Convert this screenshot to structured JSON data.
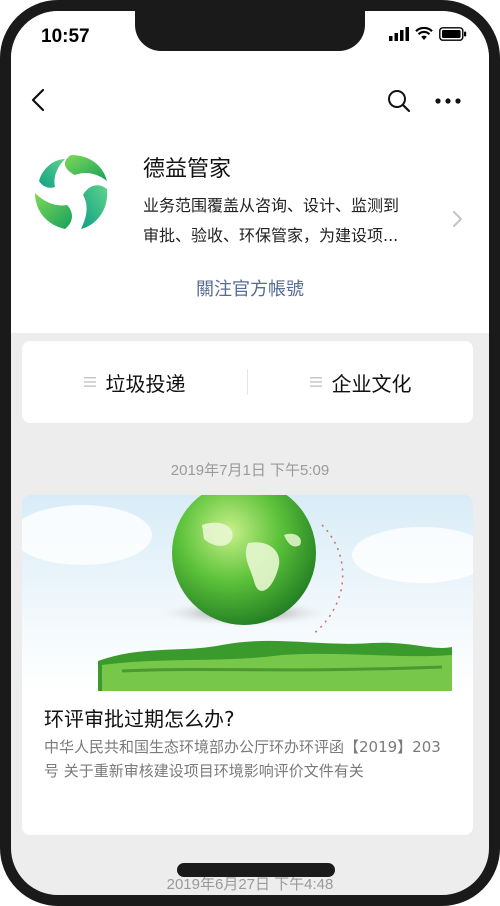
{
  "status_bar": {
    "time": "10:57"
  },
  "profile": {
    "name": "德益管家",
    "description_line1": "业务范围覆盖从咨询、设计、监测到",
    "description_line2": "审批、验收、环保管家，为建设项...",
    "follow_label": "關注官方帳號"
  },
  "menu": {
    "items": [
      {
        "label": "垃圾投递"
      },
      {
        "label": "企业文化"
      }
    ]
  },
  "feed": [
    {
      "date": "2019年7月1日 下午5:09",
      "title": "环评审批过期怎么办?",
      "summary": "中华人民共和国生态环境部办公厅环办环评函【2019】203号 关于重新审核建设项目环境影响评价文件有关"
    },
    {
      "date": "2019年6月27日 下午4:48"
    }
  ],
  "colors": {
    "link": "#576b95",
    "background": "#ededed",
    "logo_green": "#2bb56b"
  },
  "icons": [
    "back-icon",
    "search-icon",
    "more-icon",
    "chevron-right-icon",
    "menu-lines-icon",
    "signal-icon",
    "wifi-icon",
    "battery-icon"
  ]
}
